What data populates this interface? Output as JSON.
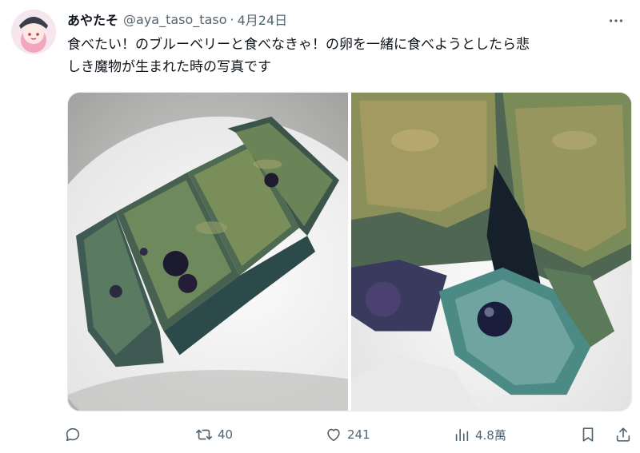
{
  "tweet": {
    "display_name": "あやたそ",
    "handle": "@aya_taso_taso",
    "separator": "·",
    "date": "4月24日",
    "text_line1": "食べたい！のブルーベリーと食べなきゃ！の卵を一緒に食べようとしたら悲",
    "text_line2": "しき魔物が生まれた時の写真です"
  },
  "actions": {
    "reply_count": "",
    "retweet_count": "40",
    "like_count": "241",
    "views_count": "4.8萬"
  },
  "icons": {
    "more": "more-icon",
    "reply": "reply-icon",
    "retweet": "retweet-icon",
    "like": "heart-icon",
    "views": "views-icon",
    "bookmark": "bookmark-icon",
    "share": "share-icon"
  },
  "colors": {
    "text": "#0f1419",
    "secondary": "#536471",
    "border": "#e7e9ea"
  }
}
